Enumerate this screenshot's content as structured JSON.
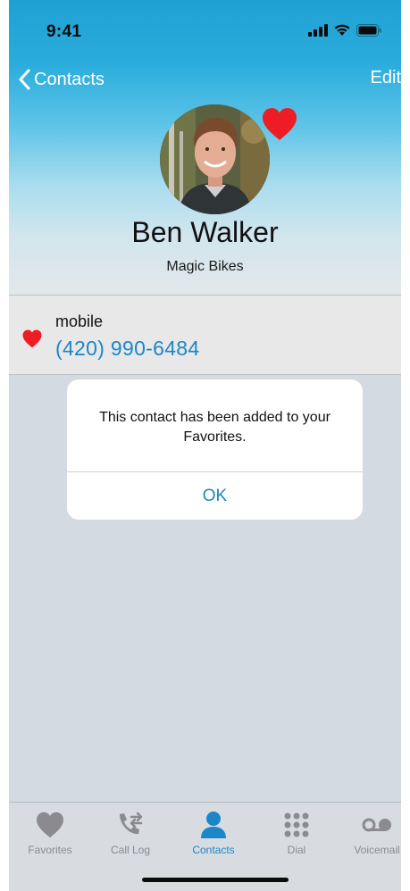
{
  "status_bar": {
    "time": "9:41"
  },
  "nav": {
    "back_label": "Contacts",
    "edit_label": "Edit"
  },
  "contact": {
    "name": "Ben Walker",
    "company": "Magic Bikes",
    "favorite": true
  },
  "phone": {
    "type": "mobile",
    "number": "(420) 990-6484"
  },
  "alert": {
    "message": "This contact has been added to your Favorites.",
    "button": "OK"
  },
  "tabs": [
    {
      "label": "Favorites",
      "icon": "heart-icon",
      "active": false
    },
    {
      "label": "Call Log",
      "icon": "call-log-icon",
      "active": false
    },
    {
      "label": "Contacts",
      "icon": "person-icon",
      "active": true
    },
    {
      "label": "Dial",
      "icon": "dialpad-icon",
      "active": false
    },
    {
      "label": "Voicemail",
      "icon": "voicemail-icon",
      "active": false
    }
  ],
  "colors": {
    "accent": "#1b86c8",
    "heart": "#ee1c25",
    "header_top": "#1fa0d3",
    "inactive": "#8a8a8f"
  }
}
